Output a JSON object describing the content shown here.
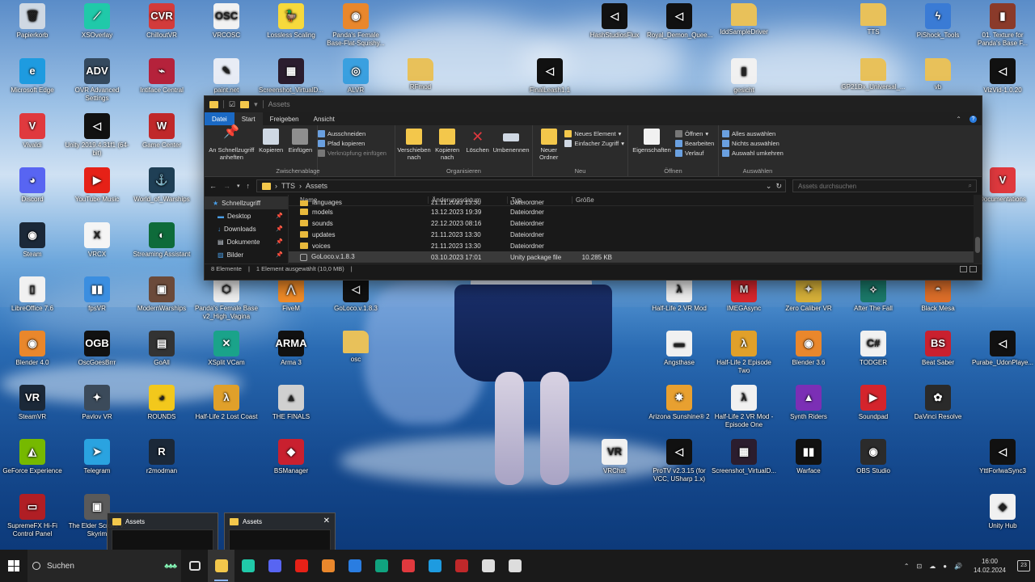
{
  "desktop": {
    "icons": [
      {
        "label": "Papierkorb",
        "glyph": "🗑",
        "color": "#cfd8e3",
        "icon": "recycle-bin-icon"
      },
      {
        "label": "XSOverlay",
        "glyph": "⟋",
        "color": "#20c9a9",
        "icon": "xsoverlay-icon"
      },
      {
        "label": "ChilloutVR",
        "glyph": "CVR",
        "color": "#d33b3b",
        "icon": "chilloutvr-icon"
      },
      {
        "label": "VRCOSC",
        "glyph": "OSC",
        "color": "#f2f2f2",
        "icon": "vrcosc-icon"
      },
      {
        "label": "Lossless Scaling",
        "glyph": "🦆",
        "color": "#f7d93c",
        "icon": "lossless-scaling-icon"
      },
      {
        "label": "Panda's Female Base-Flat-Squishy...",
        "glyph": "◉",
        "color": "#e9872c",
        "icon": "blender-icon"
      },
      {
        "label": "HashStudiosFlux",
        "glyph": "◁",
        "color": "#111111",
        "icon": "unity-icon"
      },
      {
        "label": "Royal_Demon_Quee...",
        "glyph": "◁",
        "color": "#111111",
        "icon": "unity-icon"
      },
      {
        "label": "IddSampleDriver",
        "glyph": "",
        "color": "#e8c15a",
        "icon": "folder-icon"
      },
      {
        "label": "TTS",
        "glyph": "",
        "color": "#e8c15a",
        "icon": "folder-icon"
      },
      {
        "label": "PiShock_Tools",
        "glyph": "ϟ",
        "color": "#3a7bd5",
        "icon": "pishock-icon"
      },
      {
        "label": "01. Texture for Panda's Base F...",
        "glyph": "▮",
        "color": "#8a3a2a",
        "icon": "archive-icon"
      },
      {
        "label": "Microsoft Edge",
        "glyph": "e",
        "color": "#1e9be0",
        "icon": "edge-icon"
      },
      {
        "label": "OVR Advanced Settings",
        "glyph": "ADV",
        "color": "#34495e",
        "icon": "ovr-advanced-settings-icon"
      },
      {
        "label": "Intiface Central",
        "glyph": "⌁",
        "color": "#b5223b",
        "icon": "intiface-icon"
      },
      {
        "label": "paint.net",
        "glyph": "✎",
        "color": "#e8ecf5",
        "icon": "paint-net-icon"
      },
      {
        "label": "Screenshot_VirtualD...",
        "glyph": "▦",
        "color": "#2b1d2e",
        "icon": "image-file-icon"
      },
      {
        "label": "ALVR",
        "glyph": "◎",
        "color": "#3aa0e0",
        "icon": "alvr-icon"
      },
      {
        "label": "RFmod",
        "glyph": "",
        "color": "#e8c15a",
        "icon": "folder-icon"
      },
      {
        "label": "FinalLeash1.1",
        "glyph": "◁",
        "color": "#111111",
        "icon": "unity-icon"
      },
      {
        "label": "gesicht",
        "glyph": "▮",
        "color": "#f1f1f1",
        "icon": "document-icon"
      },
      {
        "label": "GP21Dx_Universal_...",
        "glyph": "",
        "color": "#e8c15a",
        "icon": "folder-icon"
      },
      {
        "label": "vb",
        "glyph": "",
        "color": "#e8c15a",
        "icon": "folder-icon"
      },
      {
        "label": "VizVid-1.0.20",
        "glyph": "◁",
        "color": "#111111",
        "icon": "unity-icon"
      },
      {
        "label": "Vivaldi",
        "glyph": "V",
        "color": "#e0393e",
        "icon": "vivaldi-icon"
      },
      {
        "label": "Unity 2019.4.31f1 (64-bit)",
        "glyph": "◁",
        "color": "#111111",
        "icon": "unity-icon"
      },
      {
        "label": "Game Center",
        "glyph": "W",
        "color": "#c0282a",
        "icon": "game-center-icon"
      },
      {
        "label": "Discord",
        "glyph": "◕",
        "color": "#5865f2",
        "icon": "discord-icon"
      },
      {
        "label": "YouTube Music",
        "glyph": "▶",
        "color": "#e62117",
        "icon": "youtube-music-icon"
      },
      {
        "label": "World_of_Warships",
        "glyph": "⚓",
        "color": "#1f3f55",
        "icon": "world-of-warships-icon"
      },
      {
        "label": "Documentations",
        "glyph": "V",
        "color": "#e0393e",
        "icon": "vivaldi-icon"
      },
      {
        "label": "Steam",
        "glyph": "◉",
        "color": "#1b2838",
        "icon": "steam-icon"
      },
      {
        "label": "VRCX",
        "glyph": "X",
        "color": "#f5f5f5",
        "icon": "vrcx-icon"
      },
      {
        "label": "Streaming Assistant",
        "glyph": "◐",
        "color": "#0e6b3a",
        "icon": "streaming-assistant-icon"
      },
      {
        "label": "LibreOffice 7.6",
        "glyph": "▯",
        "color": "#f1f1f1",
        "icon": "libreoffice-icon"
      },
      {
        "label": "fpsVR",
        "glyph": "▮▮",
        "color": "#3b8ee0",
        "icon": "fpsvr-icon"
      },
      {
        "label": "ModernWarships",
        "glyph": "▣",
        "color": "#6b4a3a",
        "icon": "modern-warships-icon"
      },
      {
        "label": "Panda's Female Base v2_High_Vagina",
        "glyph": "⬡",
        "color": "#f1f1f1",
        "icon": "package-icon"
      },
      {
        "label": "FiveM",
        "glyph": "⋀",
        "color": "#f28c28",
        "icon": "fivem-icon"
      },
      {
        "label": "GoLoco.v.1.8.3",
        "glyph": "◁",
        "color": "#111111",
        "icon": "unity-icon"
      },
      {
        "label": "Half-Life 2 VR Mod",
        "glyph": "λ",
        "color": "#f1f1f1",
        "icon": "half-life-icon"
      },
      {
        "label": "IMEGAsync",
        "glyph": "M",
        "color": "#d9272e",
        "icon": "mega-icon"
      },
      {
        "label": "Zero Caliber VR",
        "glyph": "✦",
        "color": "#d8b23a",
        "icon": "zero-caliber-icon"
      },
      {
        "label": "After The Fall",
        "glyph": "⟡",
        "color": "#1b7a6a",
        "icon": "after-the-fall-icon"
      },
      {
        "label": "Black Mesa",
        "glyph": "◓",
        "color": "#e0702a",
        "icon": "black-mesa-icon"
      },
      {
        "label": "Blender 4.0",
        "glyph": "◉",
        "color": "#e9872c",
        "icon": "blender-icon"
      },
      {
        "label": "OscGoesBrrr",
        "glyph": "OGB",
        "color": "#111111",
        "icon": "oscgoesbrrr-icon"
      },
      {
        "label": "GoAll",
        "glyph": "▤",
        "color": "#333333",
        "icon": "goall-icon"
      },
      {
        "label": "XSplit VCam",
        "glyph": "✕",
        "color": "#1aa38a",
        "icon": "xsplit-vcam-icon"
      },
      {
        "label": "Arma 3",
        "glyph": "ARMA",
        "color": "#111111",
        "icon": "arma-icon"
      },
      {
        "label": "osc",
        "glyph": "",
        "color": "#e8c15a",
        "icon": "folder-icon"
      },
      {
        "label": "Angsthase",
        "glyph": "▬",
        "color": "#f1f1f1",
        "icon": "image-file-icon"
      },
      {
        "label": "Half-Life 2 Episode Two",
        "glyph": "λ",
        "color": "#e0a02a",
        "icon": "half-life-icon"
      },
      {
        "label": "Blender 3.6",
        "glyph": "◉",
        "color": "#e9872c",
        "icon": "blender-icon"
      },
      {
        "label": "TODGER",
        "glyph": "C#",
        "color": "#f1f1f1",
        "icon": "csharp-file-icon"
      },
      {
        "label": "Beat Saber",
        "glyph": "BS",
        "color": "#c9202f",
        "icon": "beat-saber-icon"
      },
      {
        "label": "Purabe_UdonPlaye...",
        "glyph": "◁",
        "color": "#111111",
        "icon": "unity-icon"
      },
      {
        "label": "SteamVR",
        "glyph": "VR",
        "color": "#1b2838",
        "icon": "steamvr-icon"
      },
      {
        "label": "Pavlov VR",
        "glyph": "✦",
        "color": "#3b4a5a",
        "icon": "pavlov-icon"
      },
      {
        "label": "ROUNDS",
        "glyph": "◕",
        "color": "#f2c81c",
        "icon": "rounds-icon"
      },
      {
        "label": "Half-Life 2 Lost Coast",
        "glyph": "λ",
        "color": "#e0a02a",
        "icon": "half-life-icon"
      },
      {
        "label": "THE FINALS",
        "glyph": "▲",
        "color": "#d0d0d0",
        "icon": "the-finals-icon"
      },
      {
        "label": "Arizona Sunshine® 2",
        "glyph": "✸",
        "color": "#e8a030",
        "icon": "arizona-sunshine-icon"
      },
      {
        "label": "Half-Life 2 VR Mod - Episode One",
        "glyph": "λ",
        "color": "#f1f1f1",
        "icon": "half-life-icon"
      },
      {
        "label": "Synth Riders",
        "glyph": "▲",
        "color": "#7b2fb5",
        "icon": "synth-riders-icon"
      },
      {
        "label": "Soundpad",
        "glyph": "▶",
        "color": "#d4242c",
        "icon": "soundpad-icon"
      },
      {
        "label": "DaVinci Resolve",
        "glyph": "✿",
        "color": "#2a2a2a",
        "icon": "davinci-resolve-icon"
      },
      {
        "label": "GeForce Experience",
        "glyph": "◭",
        "color": "#76b900",
        "icon": "geforce-icon"
      },
      {
        "label": "Telegram",
        "glyph": "➤",
        "color": "#2aa3e0",
        "icon": "telegram-icon"
      },
      {
        "label": "r2modman",
        "glyph": "R",
        "color": "#1b2838",
        "icon": "r2modman-icon"
      },
      {
        "label": "BSManager",
        "glyph": "◆",
        "color": "#c9202f",
        "icon": "bsmanager-icon"
      },
      {
        "label": "VRChat",
        "glyph": "VR",
        "color": "#f1f1f1",
        "icon": "vrchat-icon"
      },
      {
        "label": "ProTV v2.3.15 (for VCC, USharp 1.x)",
        "glyph": "◁",
        "color": "#111111",
        "icon": "unity-icon"
      },
      {
        "label": "Screenshot_VirtualD...",
        "glyph": "▦",
        "color": "#2b1d2e",
        "icon": "image-file-icon"
      },
      {
        "label": "Warface",
        "glyph": "▮▮",
        "color": "#111111",
        "icon": "warface-icon"
      },
      {
        "label": "OBS Studio",
        "glyph": "◉",
        "color": "#2b2b2b",
        "icon": "obs-icon"
      },
      {
        "label": "YttlForlwaSync3",
        "glyph": "◁",
        "color": "#111111",
        "icon": "unity-icon"
      },
      {
        "label": "SupremeFX Hi-Fi Control Panel",
        "glyph": "▭",
        "color": "#b01e24",
        "icon": "supremefx-icon"
      },
      {
        "label": "The Elder Scrolls V: Skyrim",
        "glyph": "▣",
        "color": "#5a5a5a",
        "icon": "skyrim-icon"
      },
      {
        "label": "Unity Hub",
        "glyph": "◈",
        "color": "#f1f1f1",
        "icon": "unity-hub-icon"
      }
    ]
  },
  "explorer": {
    "title": "Assets",
    "tabs": {
      "file": "Datei",
      "start": "Start",
      "share": "Freigeben",
      "view": "Ansicht"
    },
    "ribbon": {
      "pin_quick": "An Schnellzugriff anheften",
      "copy": "Kopieren",
      "paste": "Einfügen",
      "cut": "Ausschneiden",
      "copy_path": "Pfad kopieren",
      "paste_shortcut": "Verknüpfung einfügen",
      "group_clipboard": "Zwischenablage",
      "move_to": "Verschieben nach",
      "copy_to": "Kopieren nach",
      "delete": "Löschen",
      "rename": "Umbenennen",
      "group_organize": "Organisieren",
      "new_folder": "Neuer Ordner",
      "new_item": "Neues Element",
      "easy_access": "Einfacher Zugriff",
      "group_new": "Neu",
      "properties": "Eigenschaften",
      "open": "Öffnen",
      "edit": "Bearbeiten",
      "history": "Verlauf",
      "group_open": "Öffnen",
      "select_all": "Alles auswählen",
      "select_none": "Nichts auswählen",
      "invert_selection": "Auswahl umkehren",
      "group_select": "Auswählen"
    },
    "address": {
      "crumb1": "TTS",
      "crumb2": "Assets",
      "search_placeholder": "Assets durchsuchen"
    },
    "nav": [
      {
        "label": "Schnellzugriff",
        "pinned": false
      },
      {
        "label": "Desktop",
        "pinned": true
      },
      {
        "label": "Downloads",
        "pinned": true
      },
      {
        "label": "Dokumente",
        "pinned": true
      },
      {
        "label": "Bilder",
        "pinned": true
      }
    ],
    "columns": {
      "name": "Name",
      "date": "Änderungsdatum",
      "type": "Typ",
      "size": "Größe"
    },
    "files": [
      {
        "name": "languages",
        "date": "21.11.2023 13:30",
        "type": "Dateiordner",
        "size": "",
        "kind": "folder"
      },
      {
        "name": "models",
        "date": "13.12.2023 19:39",
        "type": "Dateiordner",
        "size": "",
        "kind": "folder"
      },
      {
        "name": "sounds",
        "date": "22.12.2023 08:16",
        "type": "Dateiordner",
        "size": "",
        "kind": "folder"
      },
      {
        "name": "updates",
        "date": "21.11.2023 13:30",
        "type": "Dateiordner",
        "size": "",
        "kind": "folder"
      },
      {
        "name": "voices",
        "date": "21.11.2023 13:30",
        "type": "Dateiordner",
        "size": "",
        "kind": "folder"
      },
      {
        "name": "GoLoco.v.1.8.3",
        "date": "03.10.2023 17:01",
        "type": "Unity package file",
        "size": "10.285 KB",
        "kind": "package"
      }
    ],
    "status": {
      "count": "8 Elemente",
      "selection": "1 Element ausgewählt (10,0 MB)"
    }
  },
  "previews": [
    {
      "title": "Assets"
    },
    {
      "title": "Assets"
    }
  ],
  "taskbar": {
    "search_placeholder": "Suchen",
    "apps": [
      {
        "name": "task-view",
        "color": "#dddddd"
      },
      {
        "name": "file-explorer",
        "color": "#f3c74b",
        "active": true
      },
      {
        "name": "xsoverlay",
        "color": "#20c9a9"
      },
      {
        "name": "discord",
        "color": "#5865f2"
      },
      {
        "name": "youtube-music",
        "color": "#e62117"
      },
      {
        "name": "blender",
        "color": "#e9872c"
      },
      {
        "name": "mail",
        "color": "#2a7de1"
      },
      {
        "name": "chatgpt",
        "color": "#10a37f"
      },
      {
        "name": "vivaldi",
        "color": "#e0393e"
      },
      {
        "name": "edge",
        "color": "#1e9be0"
      },
      {
        "name": "game-center",
        "color": "#c0282a"
      },
      {
        "name": "steam",
        "color": "#dddddd"
      },
      {
        "name": "7zip",
        "color": "#dddddd"
      }
    ],
    "time": "16:00",
    "date": "14.02.2024",
    "notifications": "23"
  }
}
